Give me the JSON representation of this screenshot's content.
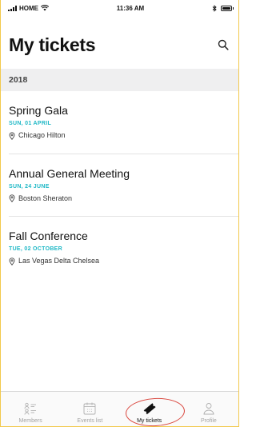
{
  "status_bar": {
    "carrier": "HOME",
    "time": "11:36 AM"
  },
  "header": {
    "title": "My tickets",
    "search_icon": "search-icon"
  },
  "section": {
    "label": "2018"
  },
  "tickets": [
    {
      "name": "Spring Gala",
      "date": "SUN, 01 APRIL",
      "venue": "Chicago Hilton"
    },
    {
      "name": "Annual General Meeting",
      "date": "SUN, 24 JUNE",
      "venue": "Boston Sheraton"
    },
    {
      "name": "Fall Conference",
      "date": "TUE, 02 OCTOBER",
      "venue": "Las Vegas Delta Chelsea"
    }
  ],
  "tabbar": {
    "tabs": [
      {
        "label": "Members",
        "icon": "members-icon"
      },
      {
        "label": "Events list",
        "icon": "calendar-icon"
      },
      {
        "label": "My tickets",
        "icon": "ticket-icon",
        "active": true
      },
      {
        "label": "Profile",
        "icon": "profile-icon"
      }
    ]
  },
  "colors": {
    "accent": "#1fb8c6",
    "highlight": "#d9443b",
    "frame": "#f2c94c"
  }
}
